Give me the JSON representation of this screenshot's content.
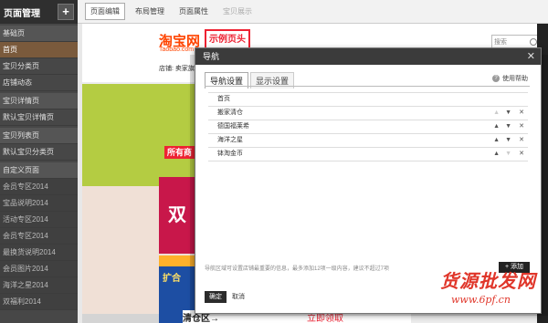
{
  "sidebar": {
    "title": "页面管理",
    "add_label": "+",
    "items": [
      {
        "label": "基础页",
        "kind": "group"
      },
      {
        "label": "首页",
        "kind": "active"
      },
      {
        "label": "宝贝分类页",
        "kind": "item"
      },
      {
        "label": "店铺动态",
        "kind": "item"
      },
      {
        "label": "宝贝详情页",
        "kind": "group"
      },
      {
        "label": "默认宝贝详情页",
        "kind": "item"
      },
      {
        "label": "宝贝列表页",
        "kind": "group"
      },
      {
        "label": "默认宝贝分类页",
        "kind": "item"
      },
      {
        "label": "自定义页面",
        "kind": "group"
      },
      {
        "label": "会员专区2014",
        "kind": "dim"
      },
      {
        "label": "宝品说明2014",
        "kind": "dim"
      },
      {
        "label": "活动专区2014",
        "kind": "dim"
      },
      {
        "label": "会员专区2014",
        "kind": "dim"
      },
      {
        "label": "最换货说明2014",
        "kind": "dim"
      },
      {
        "label": "会员图片2014",
        "kind": "dim"
      },
      {
        "label": "海洋之星2014",
        "kind": "dim"
      },
      {
        "label": "双福利2014",
        "kind": "dim"
      }
    ]
  },
  "toolbar": {
    "tabs": [
      {
        "label": "页面编辑",
        "state": "active"
      },
      {
        "label": "布局管理",
        "state": "normal"
      },
      {
        "label": "页面属性",
        "state": "normal"
      },
      {
        "label": "宝贝展示",
        "state": "disabled"
      }
    ]
  },
  "store": {
    "logo": "淘宝网",
    "logo_sub": "Taobao.com",
    "banner": "示例页头",
    "shop_line": "店铺: 卖家旗",
    "search_placeholder": "搜索",
    "tag": "所有商",
    "red_panel": "双",
    "blue_panel": "扩合",
    "bottom_left": "清仓区→",
    "bottom_claim": "立即领取"
  },
  "modal": {
    "title": "导航",
    "close_icon": "close-icon",
    "tabs": [
      {
        "label": "导航设置",
        "active": true
      },
      {
        "label": "显示设置",
        "active": false
      }
    ],
    "help_label": "使用帮助",
    "nav_items": [
      {
        "label": "首页",
        "controls": false
      },
      {
        "label": "搬家清仓",
        "controls": true,
        "up_enabled": false
      },
      {
        "label": "德国福莱希",
        "controls": true,
        "up_enabled": true
      },
      {
        "label": "海洋之星",
        "controls": true,
        "up_enabled": true
      },
      {
        "label": "钵淘金币",
        "controls": true,
        "up_enabled": true,
        "down_enabled": false
      }
    ],
    "hint": "导航区域可设置店铺最重要的信息，最多添加12项一级内容，建议不超过7项",
    "add_label": "+ 添加",
    "ok_label": "确定",
    "cancel_label": "取消"
  },
  "watermark": {
    "main": "货源批发网",
    "url": "www.6pf.cn"
  },
  "colors": {
    "sidebar_bg": "#474747",
    "sidebar_active": "#7a5a3c",
    "taobao_orange": "#ff4400",
    "watermark_red": "#e0362a"
  }
}
